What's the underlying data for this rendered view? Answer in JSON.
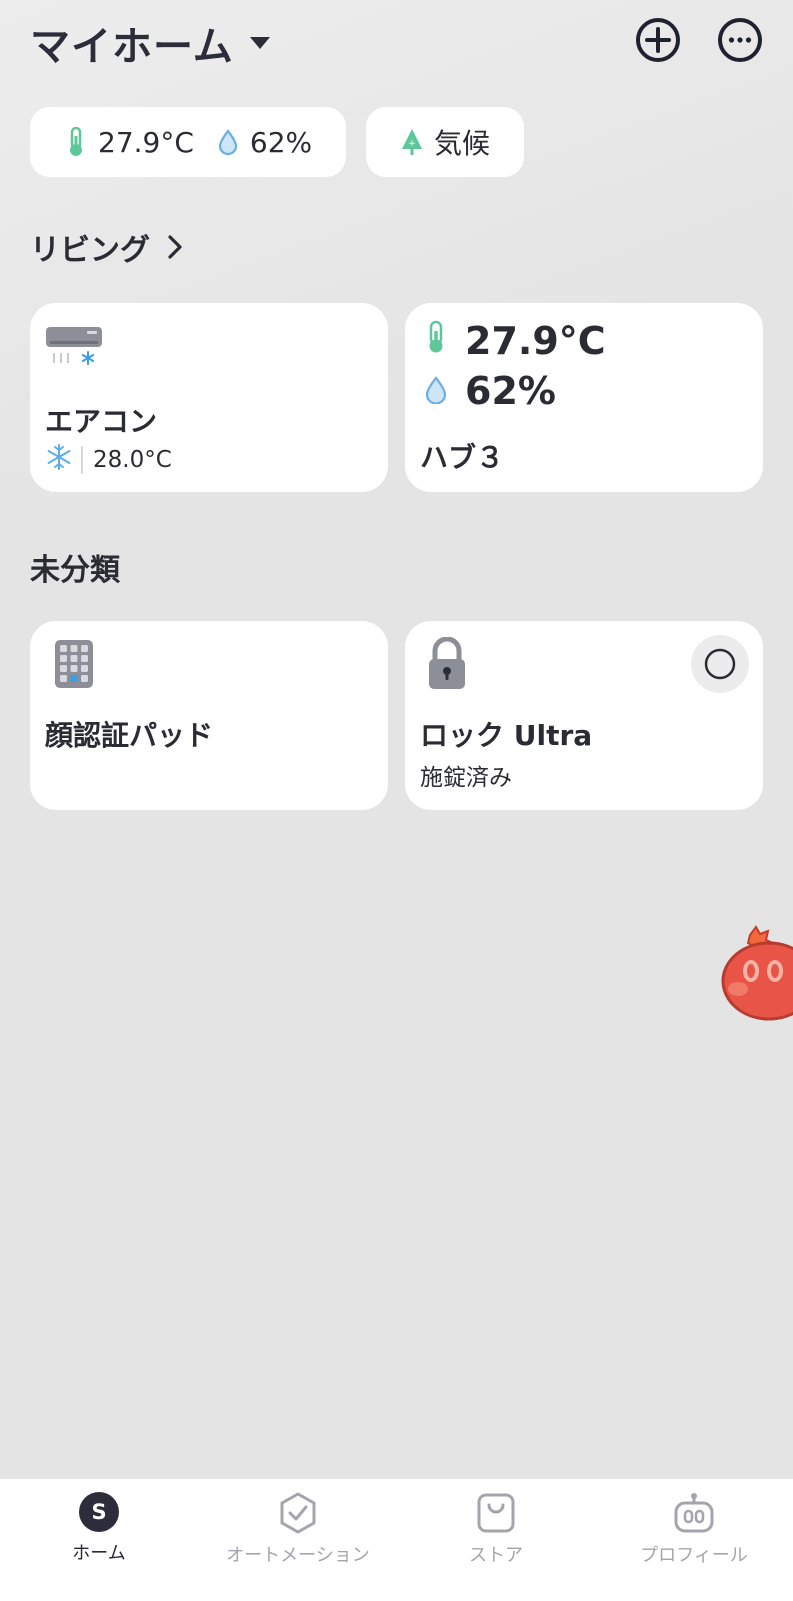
{
  "header": {
    "title": "マイホーム"
  },
  "env_pill": {
    "temperature": "27.9°C",
    "humidity": "62%"
  },
  "climate_pill": {
    "label": "気候"
  },
  "sections": {
    "living": "リビング",
    "uncategorized": "未分類"
  },
  "devices": {
    "aircon": {
      "name": "エアコン",
      "set_temp": "28.0°C"
    },
    "hub": {
      "name": "ハブ３",
      "temperature": "27.9°C",
      "humidity": "62%"
    },
    "face_pad": {
      "name": "顔認証パッド"
    },
    "lock": {
      "name": "ロック Ultra",
      "status": "施錠済み"
    }
  },
  "tabs": [
    {
      "label": "ホーム",
      "active": true
    },
    {
      "label": "オートメーション",
      "active": false
    },
    {
      "label": "ストア",
      "active": false
    },
    {
      "label": "プロフィール",
      "active": false
    }
  ],
  "icons": {
    "thermometer": "thermometer-icon",
    "humidity": "water-drop-icon",
    "climate": "tree-icon",
    "aircon": "air-conditioner-icon",
    "snowflake": "snowflake-icon",
    "keypad": "keypad-icon",
    "lock": "padlock-icon"
  },
  "colors": {
    "accent": "#2b2d3a",
    "temp_green": "#5ec79a",
    "drop_blue": "#6aaee6",
    "mascot_red": "#e85546"
  }
}
